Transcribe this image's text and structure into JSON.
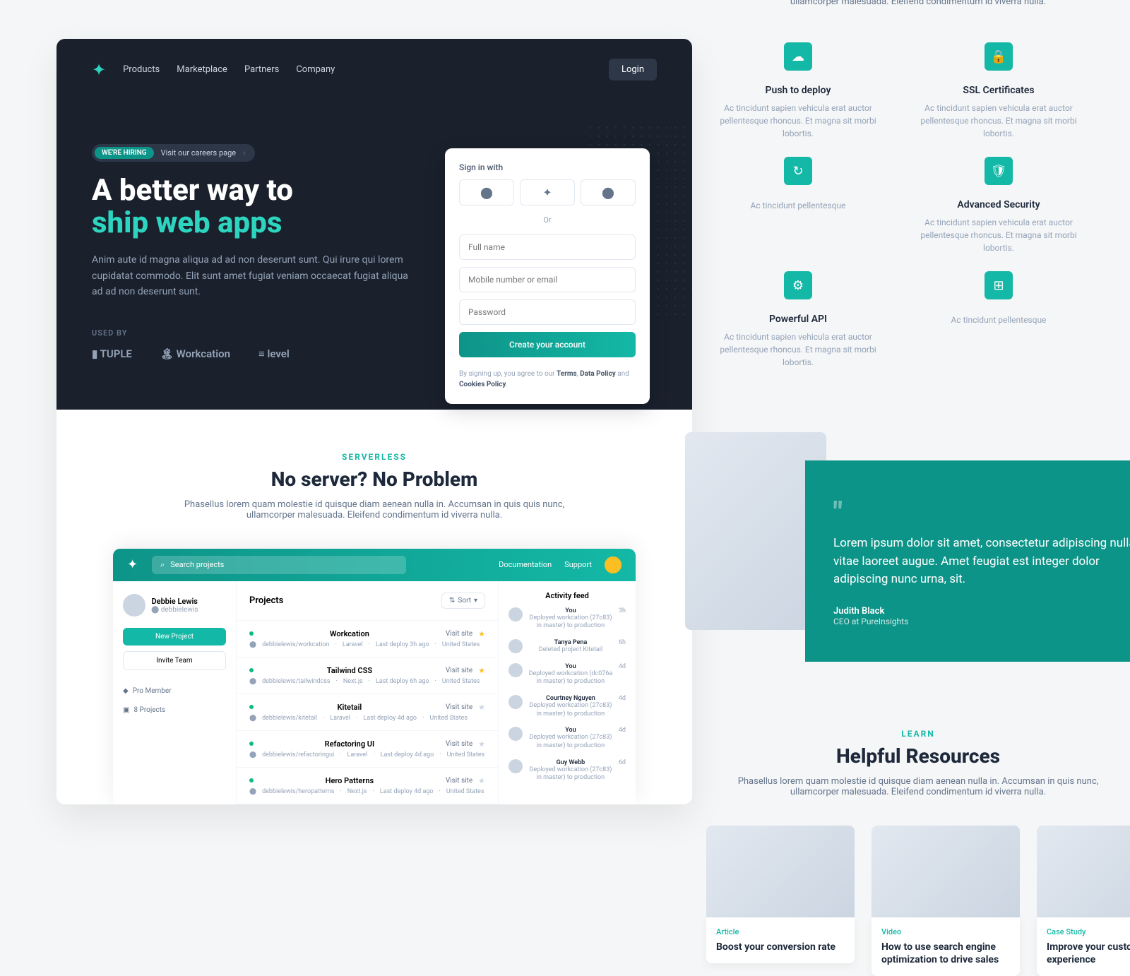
{
  "nav": {
    "links": [
      "Products",
      "Marketplace",
      "Partners",
      "Company"
    ],
    "login": "Login"
  },
  "hiring": {
    "badge": "WE'RE HIRING",
    "text": "Visit our careers page"
  },
  "hero": {
    "title_line1": "A better way to",
    "title_line2": "ship web apps",
    "sub": "Anim aute id magna aliqua ad ad non deserunt sunt. Qui irure qui lorem cupidatat commodo. Elit sunt amet fugiat veniam occaecat fugiat aliqua ad ad non deserunt sunt.",
    "used_by": "USED BY",
    "logos": [
      "TUPLE",
      "Workcation",
      "level"
    ]
  },
  "signup": {
    "label": "Sign in with",
    "or": "Or",
    "fullname": "Full name",
    "mobile": "Mobile number or email",
    "password": "Password",
    "create": "Create your account",
    "terms_pre": "By signing up, you agree to our ",
    "terms": "Terms",
    "data_policy": "Data Policy",
    "and": " and ",
    "cookies": "Cookies Policy",
    "comma": ", "
  },
  "serverless": {
    "eyebrow": "SERVERLESS",
    "title": "No server? No Problem",
    "sub": "Phasellus lorem quam molestie id quisque diam aenean nulla in. Accumsan in quis quis nunc, ullamcorper malesuada. Eleifend condimentum id viverra nulla."
  },
  "dashboard": {
    "search_placeholder": "Search projects",
    "nav": [
      "Documentation",
      "Support"
    ],
    "user": {
      "name": "Debbie Lewis",
      "handle": "debbielewis"
    },
    "new_project": "New Project",
    "invite_team": "Invite Team",
    "pro_member": "Pro Member",
    "projects_count": "8 Projects",
    "projects_title": "Projects",
    "sort": "Sort",
    "visit": "Visit site",
    "projects": [
      {
        "name": "Workcation",
        "repo": "debbielewis/workcation",
        "framework": "Laravel",
        "deploy": "Last deploy 3h ago",
        "region": "United States",
        "star": true
      },
      {
        "name": "Tailwind CSS",
        "repo": "debbielewis/tailwindcss",
        "framework": "Next.js",
        "deploy": "Last deploy 6h ago",
        "region": "United States",
        "star": true
      },
      {
        "name": "Kitetail",
        "repo": "debbielewis/kitetail",
        "framework": "Laravel",
        "deploy": "Last deploy 4d ago",
        "region": "United States",
        "star": false
      },
      {
        "name": "Refactoring UI",
        "repo": "debbielewis/refactoringui",
        "framework": "Laravel",
        "deploy": "Last deploy 4d ago",
        "region": "United States",
        "star": false
      },
      {
        "name": "Hero Patterns",
        "repo": "debbielewis/heropatterns",
        "framework": "Next.js",
        "deploy": "Last deploy 4d ago",
        "region": "United States",
        "star": false
      }
    ],
    "feed_title": "Activity feed",
    "feed": [
      {
        "name": "You",
        "desc": "Deployed workcation (27c83) in master) to production",
        "time": "3h"
      },
      {
        "name": "Tanya Pena",
        "desc": "Deleted project Kitetail",
        "time": "6h"
      },
      {
        "name": "You",
        "desc": "Deployed workcation (dc076a in master) to production",
        "time": "4d"
      },
      {
        "name": "Courtney Nguyen",
        "desc": "Deployed workcation (27c83) in master) to production",
        "time": "4d"
      },
      {
        "name": "You",
        "desc": "Deployed workcation (27c83) in master) to production",
        "time": "4d"
      },
      {
        "name": "Guy Webb",
        "desc": "Deployed workcation (27c83) in master) to production",
        "time": "6d"
      }
    ]
  },
  "features": {
    "sub": "Phasellus lorem quam molestie id quisque diam aenean nulla in. Accumsan in quis nunc, ullamcorper malesuada. Eleifend condimentum id viverra nulla.",
    "items": [
      {
        "title": "Push to deploy",
        "desc": "Ac tincidunt sapien vehicula erat auctor pellentesque rhoncus. Et magna sit morbi lobortis."
      },
      {
        "title": "SSL Certificates",
        "desc": "Ac tincidunt sapien vehicula erat auctor pellentesque rhoncus. Et magna sit morbi lobortis."
      },
      {
        "title": "",
        "desc": "Ac tincidunt pellentesque"
      },
      {
        "title": "Advanced Security",
        "desc": "Ac tincidunt sapien vehicula erat auctor pellentesque rhoncus. Et magna sit morbi lobortis."
      },
      {
        "title": "Powerful API",
        "desc": "Ac tincidunt sapien vehicula erat auctor pellentesque rhoncus. Et magna sit morbi lobortis."
      },
      {
        "title": "",
        "desc": "Ac tincidunt pellentesque"
      }
    ]
  },
  "testimonial": {
    "quote": "Lorem ipsum dolor sit amet, consectetur adipiscing nulla vitae laoreet augue. Amet feugiat est integer dolor adipiscing nunc urna, sit.",
    "author": "Judith Black",
    "role": "CEO at PureInsights"
  },
  "resources": {
    "eyebrow": "LEARN",
    "title": "Helpful Resources",
    "sub": "Phasellus lorem quam molestie id quisque diam aenean nulla in. Accumsan in quis nunc, ullamcorper malesuada. Eleifend condimentum id viverra nulla.",
    "items": [
      {
        "tag": "Article",
        "title": "Boost your conversion rate"
      },
      {
        "tag": "Video",
        "title": "How to use search engine optimization to drive sales"
      },
      {
        "tag": "Case Study",
        "title": "Improve your customer experience"
      }
    ]
  }
}
